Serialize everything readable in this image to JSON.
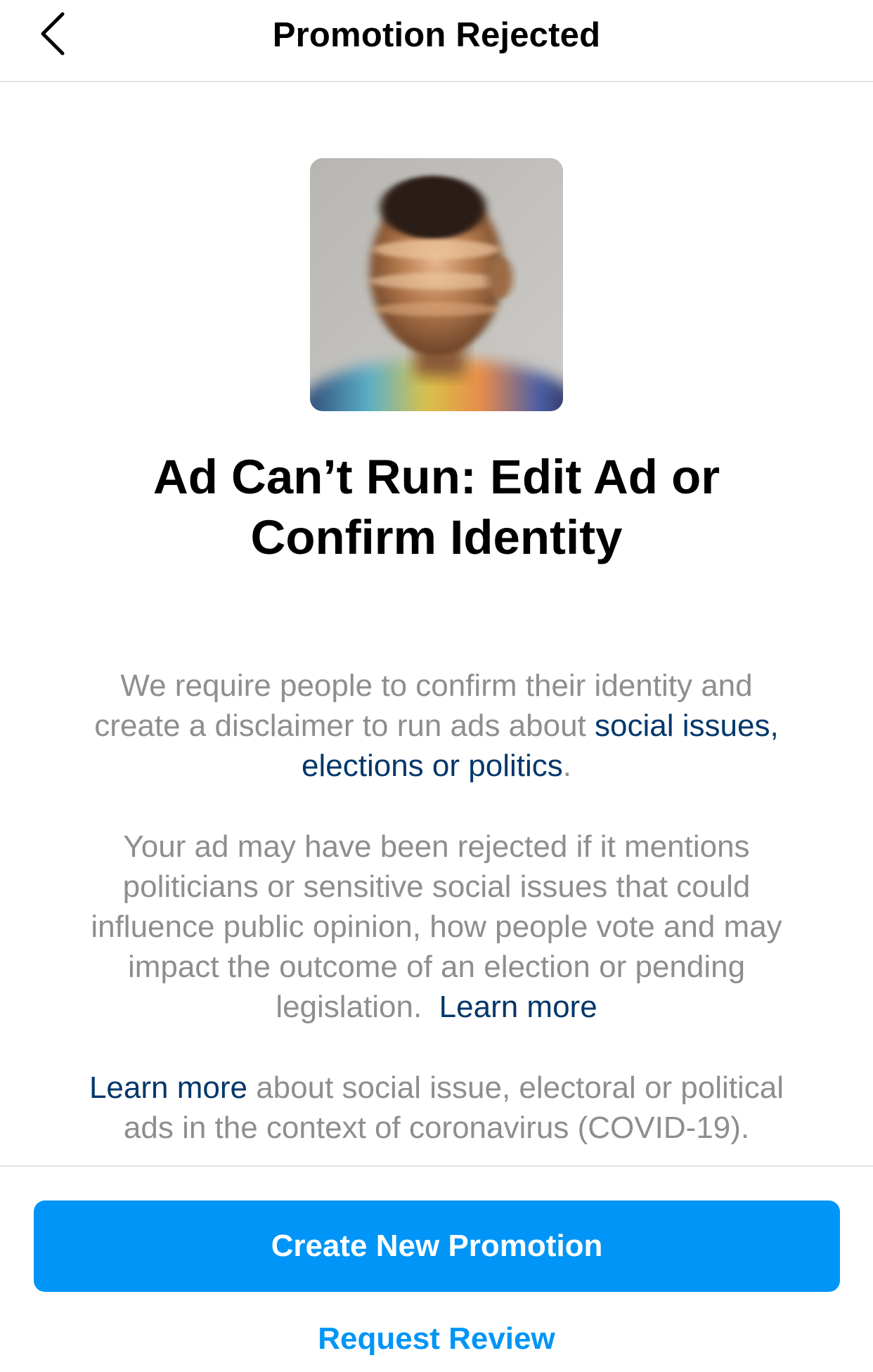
{
  "header": {
    "title": "Promotion Rejected",
    "back_icon": "chevron-left-icon"
  },
  "main": {
    "headline_line1": "Ad Can’t Run: Edit Ad or",
    "headline_line2": "Confirm Identity",
    "paragraph1": {
      "line1": "We require people to confirm their identity and",
      "line2_text": "create a disclaimer to run ads about ",
      "line2_link": "social issues,",
      "line3_link": "elections or politics",
      "line3_text": "."
    },
    "paragraph2": {
      "line1": "Your ad may have been rejected if it mentions",
      "line2": "politicians or sensitive social issues that could",
      "line3": "influence public opinion, how people vote and may",
      "line4": "impact the outcome of an election or pending",
      "line5_text": "legislation.  ",
      "line5_link": "Learn more"
    },
    "paragraph3": {
      "line1_link": "Learn more",
      "line1_text": " about social issue, electoral or political",
      "line2": "ads in the context of coronavirus (COVID-19)."
    }
  },
  "actions": {
    "primary_label": "Create New Promotion",
    "secondary_label": "Request Review"
  },
  "colors": {
    "accent": "#0095f6",
    "link": "#00376b",
    "body_text": "#8e8e8e",
    "divider": "#e4e4e4"
  }
}
